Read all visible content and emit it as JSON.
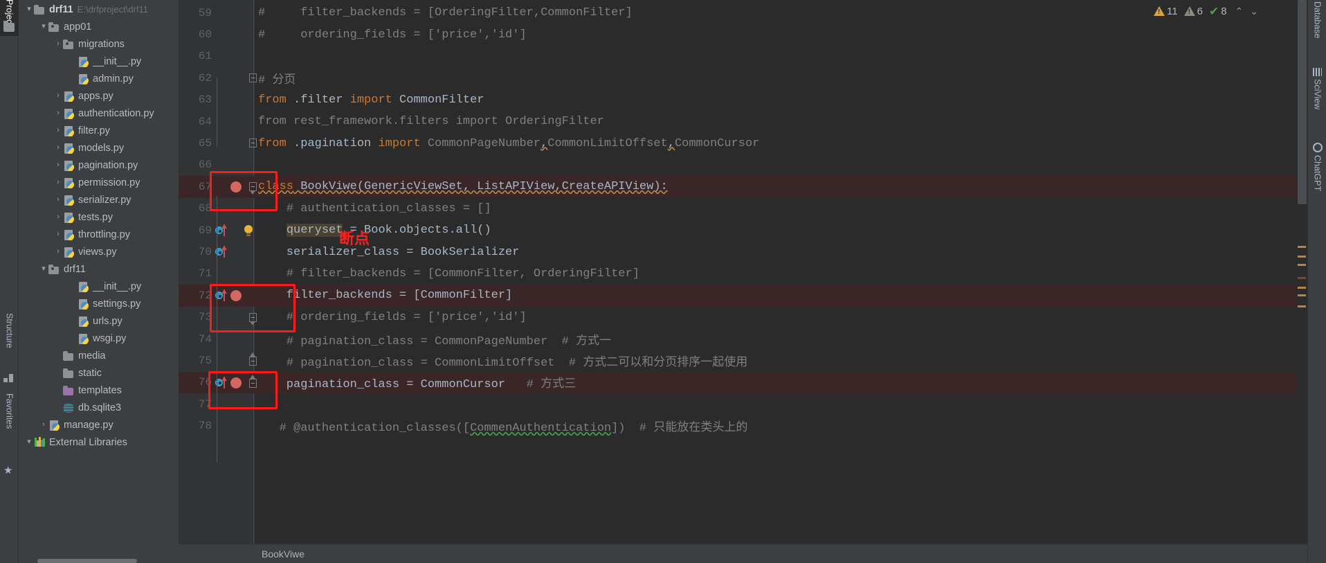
{
  "left_tool_strip": {
    "tabs": [
      {
        "name": "project",
        "label": "Project",
        "icon": "folder-icon",
        "selected": true
      },
      {
        "name": "structure",
        "label": "Structure",
        "icon": "structure-grid-icon",
        "selected": false
      },
      {
        "name": "favorites",
        "label": "Favorites",
        "icon": "star-icon",
        "selected": false
      }
    ]
  },
  "project_tree": {
    "items": [
      {
        "arrow": "▾",
        "icon": "folder",
        "label": "drf11",
        "sub": "E:\\drfproject\\drf11",
        "indent": 0,
        "bold": true
      },
      {
        "arrow": "▾",
        "icon": "folder-src",
        "label": "app01",
        "sub": "",
        "indent": 1,
        "bold": false
      },
      {
        "arrow": "›",
        "icon": "folder-src",
        "label": "migrations",
        "sub": "",
        "indent": 2,
        "bold": false
      },
      {
        "arrow": "",
        "icon": "python",
        "label": "__init__.py",
        "sub": "",
        "indent": 3,
        "bold": false
      },
      {
        "arrow": "",
        "icon": "python",
        "label": "admin.py",
        "sub": "",
        "indent": 3,
        "bold": false
      },
      {
        "arrow": "›",
        "icon": "python",
        "label": "apps.py",
        "sub": "",
        "indent": 2,
        "bold": false
      },
      {
        "arrow": "›",
        "icon": "python",
        "label": "authentication.py",
        "sub": "",
        "indent": 2,
        "bold": false
      },
      {
        "arrow": "›",
        "icon": "python",
        "label": "filter.py",
        "sub": "",
        "indent": 2,
        "bold": false
      },
      {
        "arrow": "›",
        "icon": "python",
        "label": "models.py",
        "sub": "",
        "indent": 2,
        "bold": false
      },
      {
        "arrow": "›",
        "icon": "python",
        "label": "pagination.py",
        "sub": "",
        "indent": 2,
        "bold": false
      },
      {
        "arrow": "›",
        "icon": "python",
        "label": "permission.py",
        "sub": "",
        "indent": 2,
        "bold": false
      },
      {
        "arrow": "›",
        "icon": "python",
        "label": "serializer.py",
        "sub": "",
        "indent": 2,
        "bold": false
      },
      {
        "arrow": "›",
        "icon": "python",
        "label": "tests.py",
        "sub": "",
        "indent": 2,
        "bold": false
      },
      {
        "arrow": "›",
        "icon": "python",
        "label": "throttling.py",
        "sub": "",
        "indent": 2,
        "bold": false
      },
      {
        "arrow": "›",
        "icon": "python",
        "label": "views.py",
        "sub": "",
        "indent": 2,
        "bold": false
      },
      {
        "arrow": "▾",
        "icon": "folder-src",
        "label": "drf11",
        "sub": "",
        "indent": 1,
        "bold": false
      },
      {
        "arrow": "",
        "icon": "python",
        "label": "__init__.py",
        "sub": "",
        "indent": 3,
        "bold": false
      },
      {
        "arrow": "",
        "icon": "python",
        "label": "settings.py",
        "sub": "",
        "indent": 3,
        "bold": false
      },
      {
        "arrow": "",
        "icon": "python",
        "label": "urls.py",
        "sub": "",
        "indent": 3,
        "bold": false
      },
      {
        "arrow": "",
        "icon": "python",
        "label": "wsgi.py",
        "sub": "",
        "indent": 3,
        "bold": false
      },
      {
        "arrow": "",
        "icon": "folder",
        "label": "media",
        "sub": "",
        "indent": 2,
        "bold": false
      },
      {
        "arrow": "",
        "icon": "folder",
        "label": "static",
        "sub": "",
        "indent": 2,
        "bold": false
      },
      {
        "arrow": "",
        "icon": "folder-purple",
        "label": "templates",
        "sub": "",
        "indent": 2,
        "bold": false
      },
      {
        "arrow": "",
        "icon": "database",
        "label": "db.sqlite3",
        "sub": "",
        "indent": 2,
        "bold": false
      },
      {
        "arrow": "›",
        "icon": "python",
        "label": "manage.py",
        "sub": "",
        "indent": 1,
        "bold": false
      },
      {
        "arrow": "▾",
        "icon": "libraries",
        "label": "External Libraries",
        "sub": "",
        "indent": 0,
        "bold": false
      }
    ]
  },
  "editor": {
    "lines": [
      {
        "num": "59",
        "html": "<span class='cm'>#     filter_backends = [OrderingFilter,CommonFilter]</span>",
        "gutter": {},
        "hl": false
      },
      {
        "num": "60",
        "html": "<span class='cm'>#     ordering_fields = ['price','id']</span>",
        "gutter": {},
        "hl": false
      },
      {
        "num": "61",
        "html": "",
        "gutter": {},
        "hl": false
      },
      {
        "num": "62",
        "html": "<span class='cm'># 分页</span>",
        "gutter": {
          "fold": "box"
        },
        "hl": false
      },
      {
        "num": "63",
        "html": "<span class='kw'>from</span> .filter <span class='kw'>import</span> CommonFilter",
        "gutter": {},
        "hl": false
      },
      {
        "num": "64",
        "html": "<span class='cm'>from rest_framework.filters import OrderingFilter</span>",
        "gutter": {},
        "hl": false
      },
      {
        "num": "65",
        "html": "<span class='kw'>from</span> .pagination <span class='kw'>import</span> <span class='cm'>CommonPageNumber</span><span class='wavy'>,</span><span class='cm'>CommonLimitOffset</span><span class='wavy'>,</span><span class='cm'>CommonCursor</span>",
        "gutter": {
          "fold": "box"
        },
        "hl": false
      },
      {
        "num": "66",
        "html": "",
        "gutter": {},
        "hl": false
      },
      {
        "num": "67",
        "html": "<span class='kw wavy'>class</span><span class='wavy'> </span><span class='cls wavy'>BookViwe</span><span class='wavy'>(GenericViewSet, ListAPIView,CreateAPIView):</span>",
        "gutter": {
          "bp": true,
          "fold": "tri-dn"
        },
        "hl": true
      },
      {
        "num": "68",
        "html": "    <span class='cm'># authentication_classes = []</span>",
        "gutter": {},
        "hl": false
      },
      {
        "num": "69",
        "html": "    <span class='warnbg'>queryset</span> = Book.objects.all()",
        "gutter": {
          "ovr": true,
          "bulb": true
        },
        "hl": false
      },
      {
        "num": "70",
        "html": "    serializer_class = BookSerializer",
        "gutter": {
          "ovr": true
        },
        "hl": false
      },
      {
        "num": "71",
        "html": "    <span class='cm'># filter_backends = [CommonFilter, OrderingFilter]</span>",
        "gutter": {},
        "hl": false
      },
      {
        "num": "72",
        "html": "    filter_backends = [CommonFilter]",
        "gutter": {
          "ovr": true,
          "bp": true
        },
        "hl": true
      },
      {
        "num": "73",
        "html": "    <span class='cm'># ordering_fields = ['price','id']</span>",
        "gutter": {
          "fold": "tri-dn2"
        },
        "hl": false
      },
      {
        "num": "74",
        "html": "    <span class='cm'># pagination_class = CommonPageNumber  # 方式一</span>",
        "gutter": {},
        "hl": false
      },
      {
        "num": "75",
        "html": "    <span class='cm'># pagination_class = CommonLimitOffset  # 方式二可以和分页排序一起使用</span>",
        "gutter": {
          "fold": "tri-up"
        },
        "hl": false
      },
      {
        "num": "76",
        "html": "    pagination_class = CommonCursor   <span class='cm'># 方式三</span>",
        "gutter": {
          "ovr": true,
          "bp": true,
          "fold": "tri-up2"
        },
        "hl": true
      },
      {
        "num": "77",
        "html": "",
        "gutter": {},
        "hl": false
      },
      {
        "num": "78",
        "html": "   <span class='cm'># @authentication_classes([<span class='wavy-g'>CommenAuthentication</span>])  # 只能放在类头上的</span>",
        "gutter": {},
        "hl": false
      }
    ],
    "annotation_text": "断点",
    "breadcrumb": "BookViwe"
  },
  "inspections": {
    "warnings_count": "11",
    "weak_warnings_count": "6",
    "ok_count": "8",
    "prev_label": "⌃",
    "next_label": "⌄"
  },
  "right_tool_strip": {
    "tabs": [
      {
        "name": "database",
        "label": "Database",
        "icon": "database-icon"
      },
      {
        "name": "sciview",
        "label": "SciView",
        "icon": "grid-icon"
      },
      {
        "name": "chatgpt",
        "label": "ChatGPT",
        "icon": "openai-icon"
      }
    ]
  },
  "colors": {
    "accent_red": "#ff1a1a",
    "breakpoint": "#d4675f",
    "keyword": "#cc7832",
    "comment": "#808080",
    "warning": "#d9a343",
    "ok": "#5a9b4f"
  }
}
